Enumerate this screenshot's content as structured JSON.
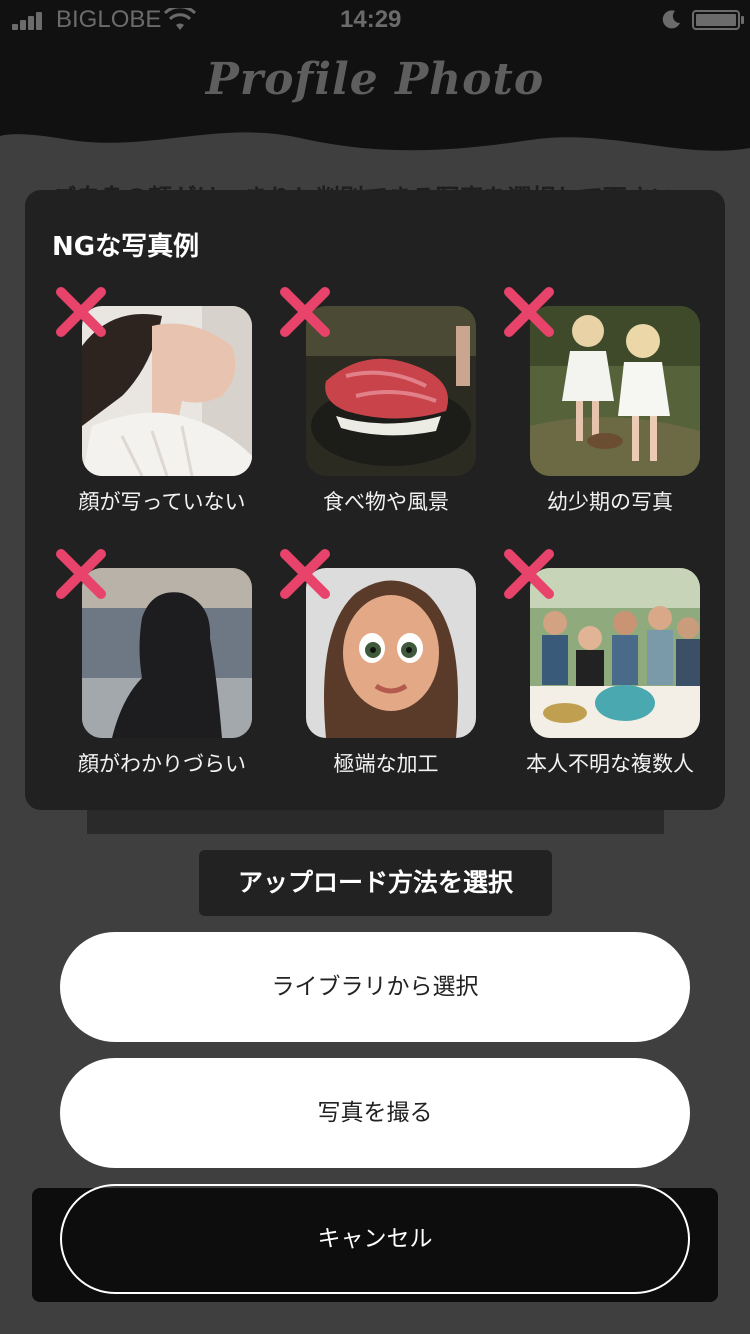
{
  "status_bar": {
    "carrier": "BIGLOBE",
    "time": "14:29",
    "icons": [
      "signal-icon",
      "wifi-icon",
      "moon-icon",
      "battery-icon"
    ]
  },
  "header": {
    "title": "Profile Photo"
  },
  "background_instruction": "ご自身の顔がはっきりと判別できる写真を選択して下さい",
  "ng_card": {
    "title": "NGな写真例",
    "items": [
      {
        "label": "顔が写っていない",
        "icon": "close-icon"
      },
      {
        "label": "食べ物や風景",
        "icon": "close-icon"
      },
      {
        "label": "幼少期の写真",
        "icon": "close-icon"
      },
      {
        "label": "顔がわかりづらい",
        "icon": "close-icon"
      },
      {
        "label": "極端な加工",
        "icon": "close-icon"
      },
      {
        "label": "本人不明な複数人",
        "icon": "close-icon"
      }
    ]
  },
  "action_sheet": {
    "title": "アップロード方法を選択",
    "library_label": "ライブラリから選択",
    "camera_label": "写真を撮る",
    "cancel_label": "キャンセル"
  },
  "colors": {
    "x_mark": "#e8436a",
    "card_bg": "#212121",
    "overlay_bg": "#3f3f3f"
  }
}
